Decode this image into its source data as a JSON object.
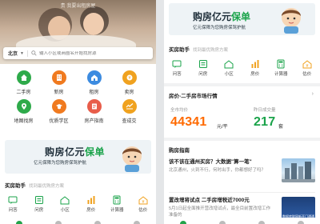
{
  "left": {
    "hero_subtitle": "贵 我要出租房屋",
    "search": {
      "city": "北京",
      "placeholder": "输入小区或商圈名开始找房源"
    },
    "grid": [
      {
        "label": "二手房",
        "icon": "house-icon",
        "color": "#2eaa4a"
      },
      {
        "label": "新房",
        "icon": "building-icon",
        "color": "#f07a1f"
      },
      {
        "label": "租房",
        "icon": "rent-icon",
        "color": "#3c8be0"
      },
      {
        "label": "卖房",
        "icon": "sell-icon",
        "color": "#f0a21f"
      },
      {
        "label": "地图找房",
        "icon": "map-icon",
        "color": "#2eaa4a"
      },
      {
        "label": "优质学区",
        "icon": "school-icon",
        "color": "#f07a1f"
      },
      {
        "label": "房产指南",
        "icon": "guide-icon",
        "color": "#e85d4a"
      },
      {
        "label": "查成交",
        "icon": "deal-icon",
        "color": "#f0a21f"
      }
    ],
    "banner": {
      "title_a": "购房亿元",
      "title_b": "保单",
      "subtitle": "亿元保障为您购房保驾护航"
    },
    "helper": {
      "title": "买房助手",
      "hint": "找到最优购房方案"
    },
    "tools": [
      {
        "label": "问答",
        "icon": "qa-icon"
      },
      {
        "label": "问房",
        "icon": "ask-house-icon"
      },
      {
        "label": "小区",
        "icon": "community-icon"
      },
      {
        "label": "房价",
        "icon": "price-icon"
      },
      {
        "label": "计算器",
        "icon": "calculator-icon"
      },
      {
        "label": "估价",
        "icon": "valuation-icon"
      }
    ]
  },
  "right": {
    "banner": {
      "title_a": "购房亿元",
      "title_b": "保单",
      "subtitle": "亿元保障为您购房保驾护航"
    },
    "helper": {
      "title": "买房助手",
      "hint": "找到最优购房方案"
    },
    "tools": [
      {
        "label": "问答",
        "icon": "qa-icon"
      },
      {
        "label": "问房",
        "icon": "ask-house-icon"
      },
      {
        "label": "小区",
        "icon": "community-icon"
      },
      {
        "label": "房价",
        "icon": "price-icon"
      },
      {
        "label": "计算器",
        "icon": "calculator-icon"
      },
      {
        "label": "估价",
        "icon": "valuation-icon"
      }
    ],
    "market": {
      "title": "房价-二手房市场行情",
      "avg_label": "全市均价",
      "avg_value": "44341",
      "avg_unit": "元/平",
      "new_label": "昨日成交量",
      "new_value": "217",
      "new_unit": "套"
    },
    "guide": {
      "title": "购房指南",
      "articles": [
        {
          "title": "该不该在通州买房？大数据\"算一笔\"",
          "desc": "北京通州，火到不行，何时出手，你都想好了吗？",
          "thumb_caption": ""
        },
        {
          "title": "置改增将试点 二手房增税近7000元",
          "desc": "5月1日起全面推开营改增试点，最全目前置改增工作准备的",
          "thumb_caption": "数据库联网新开门通通"
        }
      ]
    }
  },
  "colors": {
    "accent": "#1aa34a",
    "price": "#ff6a00"
  }
}
